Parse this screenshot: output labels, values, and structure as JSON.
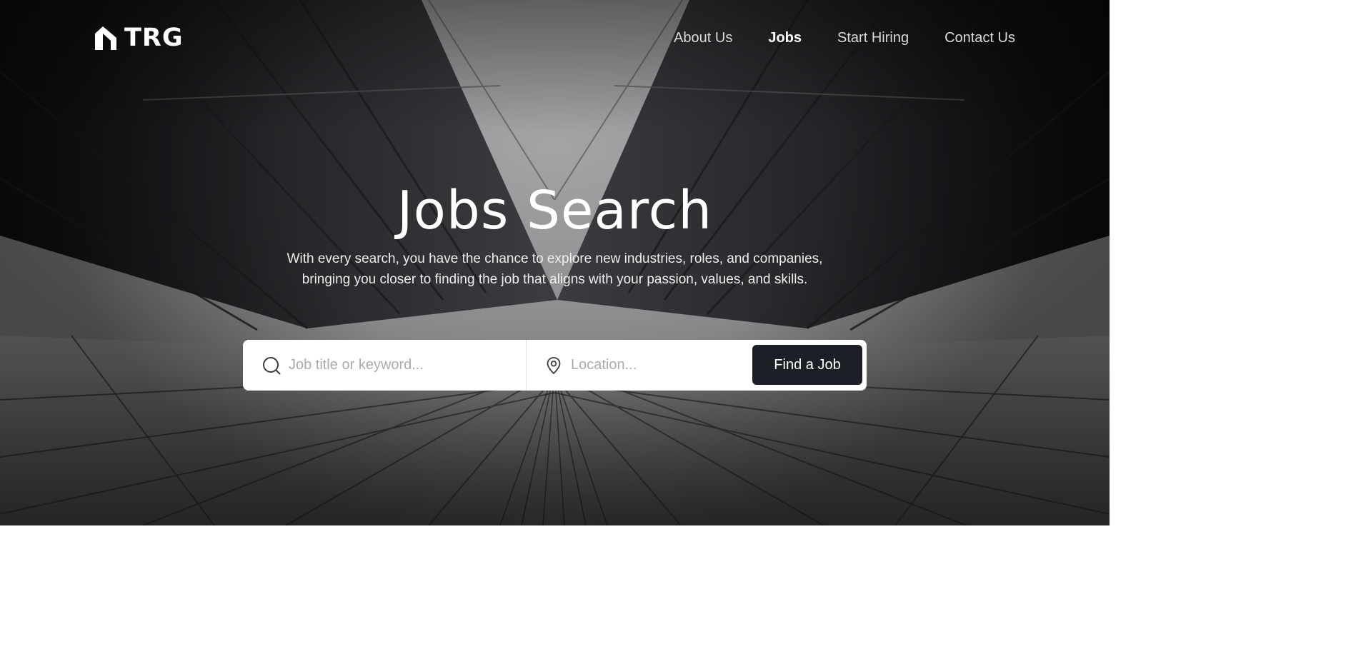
{
  "brand": {
    "name": "TRG"
  },
  "nav": {
    "items": [
      {
        "label": "About Us",
        "active": false
      },
      {
        "label": "Jobs",
        "active": true
      },
      {
        "label": "Start Hiring",
        "active": false
      },
      {
        "label": "Contact Us",
        "active": false
      }
    ]
  },
  "hero": {
    "title": "Jobs Search",
    "subtitle": "With every search, you have the chance to explore new industries, roles, and companies, bringing you closer to finding the job that aligns with your passion, values, and skills."
  },
  "search": {
    "keyword_placeholder": "Job title or keyword...",
    "keyword_value": "",
    "location_placeholder": "Location...",
    "location_value": "",
    "button_label": "Find a Job",
    "keyword_icon": "search-icon",
    "location_icon": "map-pin-icon"
  },
  "colors": {
    "button_bg": "#1c1f26",
    "text_light": "#ffffff",
    "placeholder": "#a8abb0"
  }
}
